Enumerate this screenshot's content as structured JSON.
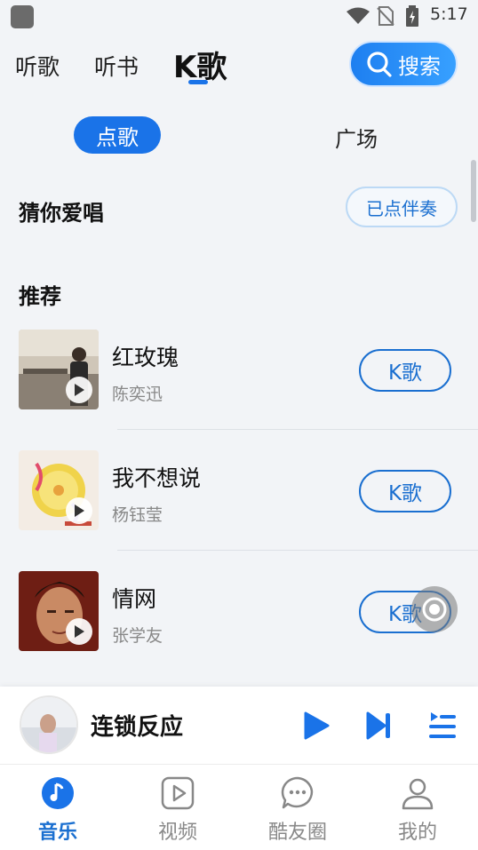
{
  "status_bar": {
    "time": "5:17"
  },
  "top_tabs": [
    {
      "label": "听歌"
    },
    {
      "label": "听书"
    },
    {
      "label": "K歌",
      "active": true
    }
  ],
  "search_button": {
    "label": "搜索"
  },
  "sub_tabs": [
    {
      "label": "点歌",
      "active": true
    },
    {
      "label": "广场"
    }
  ],
  "sections": {
    "guess": {
      "title": "猜你爱唱",
      "button_label": "已点伴奏"
    },
    "recommend": {
      "title": "推荐"
    }
  },
  "songs": [
    {
      "title": "红玫瑰",
      "artist": "陈奕迅",
      "action_label": "K歌"
    },
    {
      "title": "我不想说",
      "artist": "杨钰莹",
      "action_label": "K歌"
    },
    {
      "title": "情网",
      "artist": "张学友",
      "action_label": "K歌"
    }
  ],
  "mini_player": {
    "title": "连锁反应"
  },
  "bottom_nav": [
    {
      "label": "音乐",
      "icon": "music-note-icon",
      "active": true
    },
    {
      "label": "视频",
      "icon": "video-play-icon"
    },
    {
      "label": "酷友圈",
      "icon": "chat-bubble-icon"
    },
    {
      "label": "我的",
      "icon": "user-icon"
    }
  ],
  "colors": {
    "accent": "#1a73e8",
    "accent_text": "#1a6fd0",
    "background": "#f2f4f7"
  }
}
